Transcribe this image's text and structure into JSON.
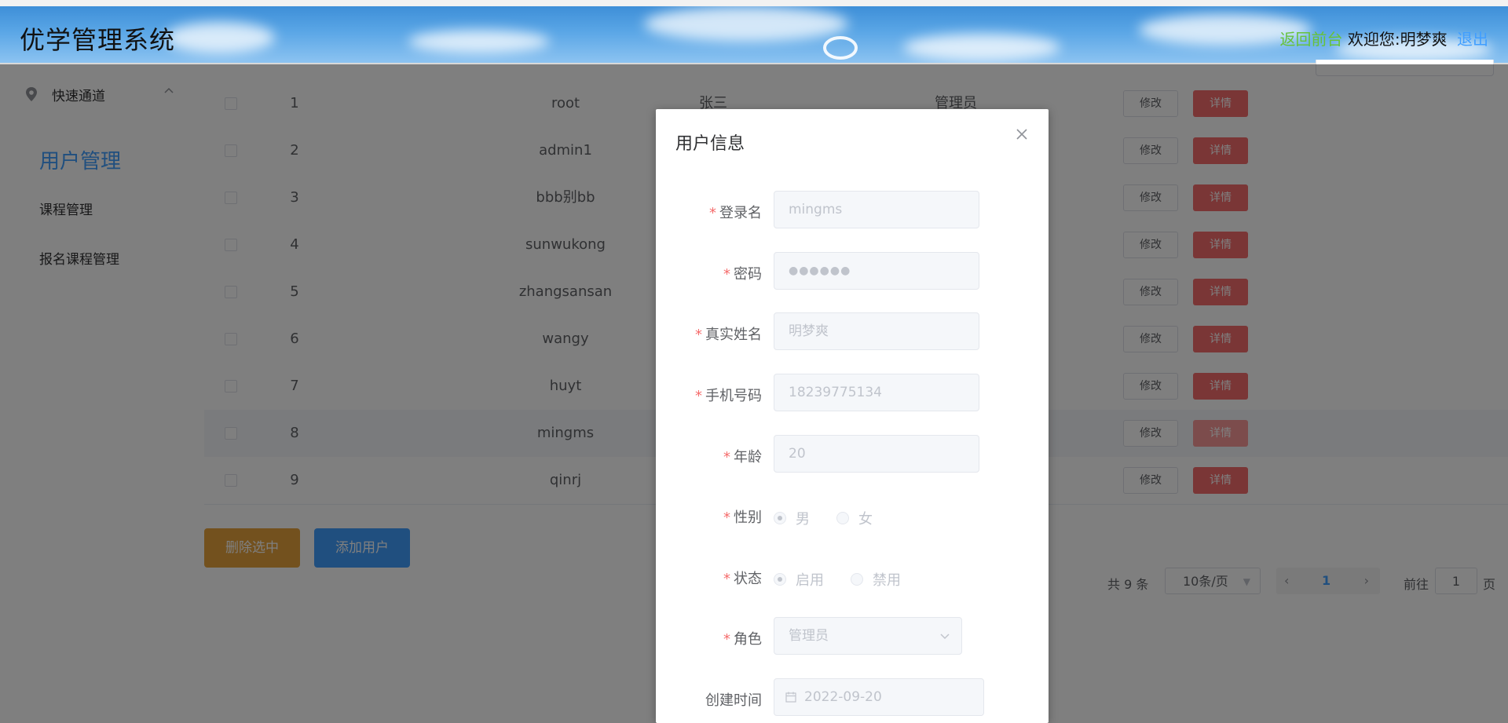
{
  "header": {
    "title": "优学管理系统",
    "back_label": "返回前台",
    "welcome_label": "欢迎您:明梦爽",
    "logout_label": "退出"
  },
  "sidebar": {
    "group_label": "快速通道",
    "items": [
      {
        "label": "用户管理",
        "active": true
      },
      {
        "label": "课程管理",
        "active": false
      },
      {
        "label": "报名课程管理",
        "active": false
      }
    ]
  },
  "table": {
    "rows": [
      {
        "id": "1",
        "name": "root",
        "real_name": "张三",
        "role": "管理员"
      },
      {
        "id": "2",
        "name": "admin1"
      },
      {
        "id": "3",
        "name": "bbb别bb"
      },
      {
        "id": "4",
        "name": "sunwukong"
      },
      {
        "id": "5",
        "name": "zhangsansan"
      },
      {
        "id": "6",
        "name": "wangy"
      },
      {
        "id": "7",
        "name": "huyt"
      },
      {
        "id": "8",
        "name": "mingms"
      },
      {
        "id": "9",
        "name": "qinrj"
      }
    ],
    "edit_label": "修改",
    "detail_label": "详情"
  },
  "actions": {
    "bulk_delete_label": "删除选中",
    "add_user_label": "添加用户"
  },
  "pagination": {
    "total_label": "共 9 条",
    "page_size_label": "10条/页",
    "current_page": "1",
    "goto_label": "前往",
    "goto_value": "1",
    "page_suffix": "页"
  },
  "dialog": {
    "title": "用户信息",
    "fields": {
      "login_name": {
        "label": "登录名",
        "value": "mingms"
      },
      "password": {
        "label": "密码",
        "value": "●●●●●●"
      },
      "real_name": {
        "label": "真实姓名",
        "value": "明梦爽"
      },
      "phone": {
        "label": "手机号码",
        "value": "18239775134"
      },
      "age": {
        "label": "年龄",
        "value": "20"
      },
      "gender": {
        "label": "性别",
        "options": [
          "男",
          "女"
        ],
        "selected": "男"
      },
      "status": {
        "label": "状态",
        "options": [
          "启用",
          "禁用"
        ],
        "selected": "启用"
      },
      "role": {
        "label": "角色",
        "value": "管理员"
      },
      "created": {
        "label": "创建时间",
        "value": "2022-09-20"
      }
    }
  },
  "colors": {
    "primary": "#409eff",
    "danger": "#f56c6c",
    "warning": "#e6a23c",
    "success": "#67c23a"
  }
}
